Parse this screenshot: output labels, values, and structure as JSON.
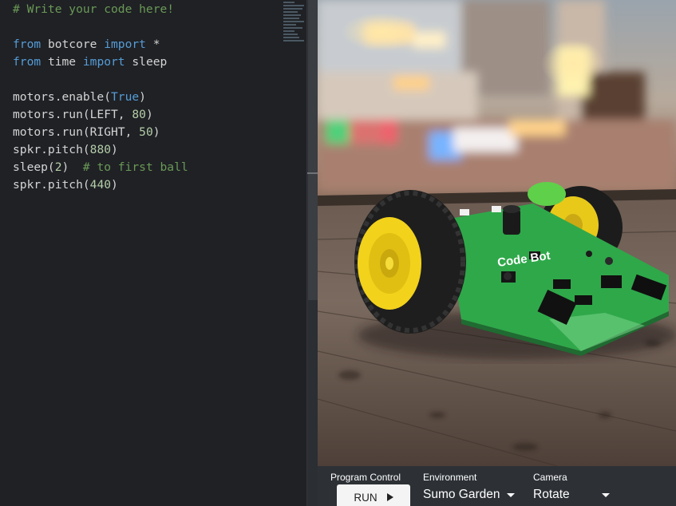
{
  "editor": {
    "lines": [
      [
        {
          "t": "comment",
          "s": "# Write your code here!"
        }
      ],
      [],
      [
        {
          "t": "keyword",
          "s": "from"
        },
        {
          "t": "plain",
          "s": " botcore "
        },
        {
          "t": "keyword",
          "s": "import"
        },
        {
          "t": "plain",
          "s": " *"
        }
      ],
      [
        {
          "t": "keyword",
          "s": "from"
        },
        {
          "t": "plain",
          "s": " time "
        },
        {
          "t": "keyword",
          "s": "import"
        },
        {
          "t": "plain",
          "s": " sleep"
        }
      ],
      [],
      [
        {
          "t": "plain",
          "s": "motors.enable("
        },
        {
          "t": "const",
          "s": "True"
        },
        {
          "t": "plain",
          "s": ")"
        }
      ],
      [
        {
          "t": "plain",
          "s": "motors.run(LEFT, "
        },
        {
          "t": "number",
          "s": "80"
        },
        {
          "t": "plain",
          "s": ")"
        }
      ],
      [
        {
          "t": "plain",
          "s": "motors.run(RIGHT, "
        },
        {
          "t": "number",
          "s": "50"
        },
        {
          "t": "plain",
          "s": ")"
        }
      ],
      [
        {
          "t": "plain",
          "s": "spkr.pitch("
        },
        {
          "t": "number",
          "s": "880"
        },
        {
          "t": "plain",
          "s": ")"
        }
      ],
      [
        {
          "t": "plain",
          "s": "sleep("
        },
        {
          "t": "number",
          "s": "2"
        },
        {
          "t": "plain",
          "s": ")  "
        },
        {
          "t": "comment",
          "s": "# to first ball"
        }
      ],
      [
        {
          "t": "plain",
          "s": "spkr.pitch("
        },
        {
          "t": "number",
          "s": "440"
        },
        {
          "t": "plain",
          "s": ")"
        }
      ]
    ]
  },
  "robot": {
    "board_label": "Code Bot"
  },
  "controls": {
    "program_label": "Program Control",
    "run_label": "RUN",
    "environment_label": "Environment",
    "environment_value": "Sumo Garden",
    "camera_label": "Camera",
    "camera_value": "Rotate"
  },
  "colors": {
    "editor_bg": "#1f2125",
    "comment": "#6a9955",
    "keyword": "#569cd6",
    "number": "#b5cea8",
    "pcb_green": "#2fa84a",
    "wheel_yellow": "#f2d21b",
    "controls_bg": "#2d3136"
  }
}
